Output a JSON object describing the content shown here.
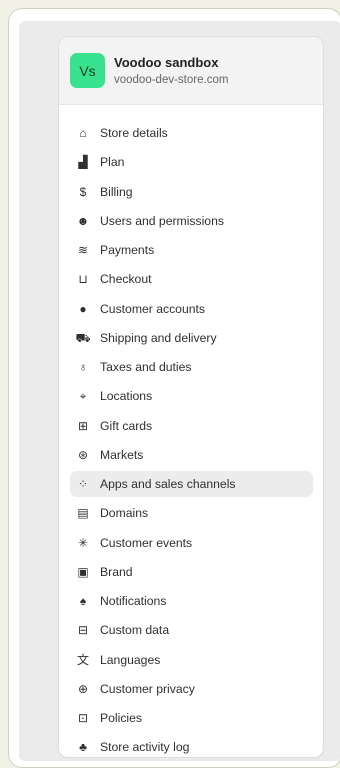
{
  "store": {
    "avatar_initials": "Vs",
    "name": "Voodoo sandbox",
    "domain": "voodoo-dev-store.com",
    "avatar_color": "#38e28f"
  },
  "menu": {
    "active_index": 12,
    "items": [
      {
        "label": "Store details",
        "icon": "store-icon"
      },
      {
        "label": "Plan",
        "icon": "plan-icon"
      },
      {
        "label": "Billing",
        "icon": "billing-icon"
      },
      {
        "label": "Users and permissions",
        "icon": "users-icon"
      },
      {
        "label": "Payments",
        "icon": "payments-icon"
      },
      {
        "label": "Checkout",
        "icon": "cart-icon"
      },
      {
        "label": "Customer accounts",
        "icon": "person-icon"
      },
      {
        "label": "Shipping and delivery",
        "icon": "truck-icon"
      },
      {
        "label": "Taxes and duties",
        "icon": "money-bag-icon"
      },
      {
        "label": "Locations",
        "icon": "location-pin-icon"
      },
      {
        "label": "Gift cards",
        "icon": "gift-card-icon"
      },
      {
        "label": "Markets",
        "icon": "globe-icon"
      },
      {
        "label": "Apps and sales channels",
        "icon": "apps-icon"
      },
      {
        "label": "Domains",
        "icon": "domain-icon"
      },
      {
        "label": "Customer events",
        "icon": "cursor-click-icon"
      },
      {
        "label": "Brand",
        "icon": "brand-icon"
      },
      {
        "label": "Notifications",
        "icon": "bell-icon"
      },
      {
        "label": "Custom data",
        "icon": "custom-data-icon"
      },
      {
        "label": "Languages",
        "icon": "language-icon"
      },
      {
        "label": "Customer privacy",
        "icon": "lock-icon"
      },
      {
        "label": "Policies",
        "icon": "policies-icon"
      },
      {
        "label": "Store activity log",
        "icon": "activity-log-icon"
      }
    ]
  }
}
